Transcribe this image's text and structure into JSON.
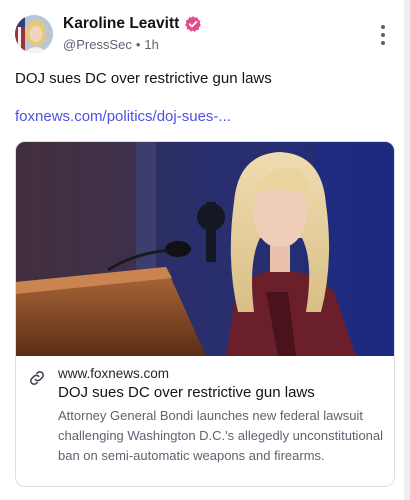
{
  "post": {
    "author": {
      "display_name": "Karoline Leavitt",
      "handle": "@PressSec",
      "separator": "•",
      "time": "1h",
      "verified": true
    },
    "text": "DOJ sues DC over restrictive gun laws",
    "link_text": "foxnews.com/politics/doj-sues-...",
    "card": {
      "domain": "www.foxnews.com",
      "title": "DOJ sues DC over restrictive gun laws",
      "description": "Attorney General Bondi launches new federal lawsuit challenging Washington D.C.'s allegedly unconstitutional ban on semi-automatic weapons and firearms."
    }
  },
  "colors": {
    "link": "#4f52e2",
    "verified_badge": "#e54b8a",
    "muted_text": "#5b6470"
  },
  "icons": {
    "more": "more-options-icon",
    "link": "link-icon",
    "verified": "verified-badge-icon"
  }
}
